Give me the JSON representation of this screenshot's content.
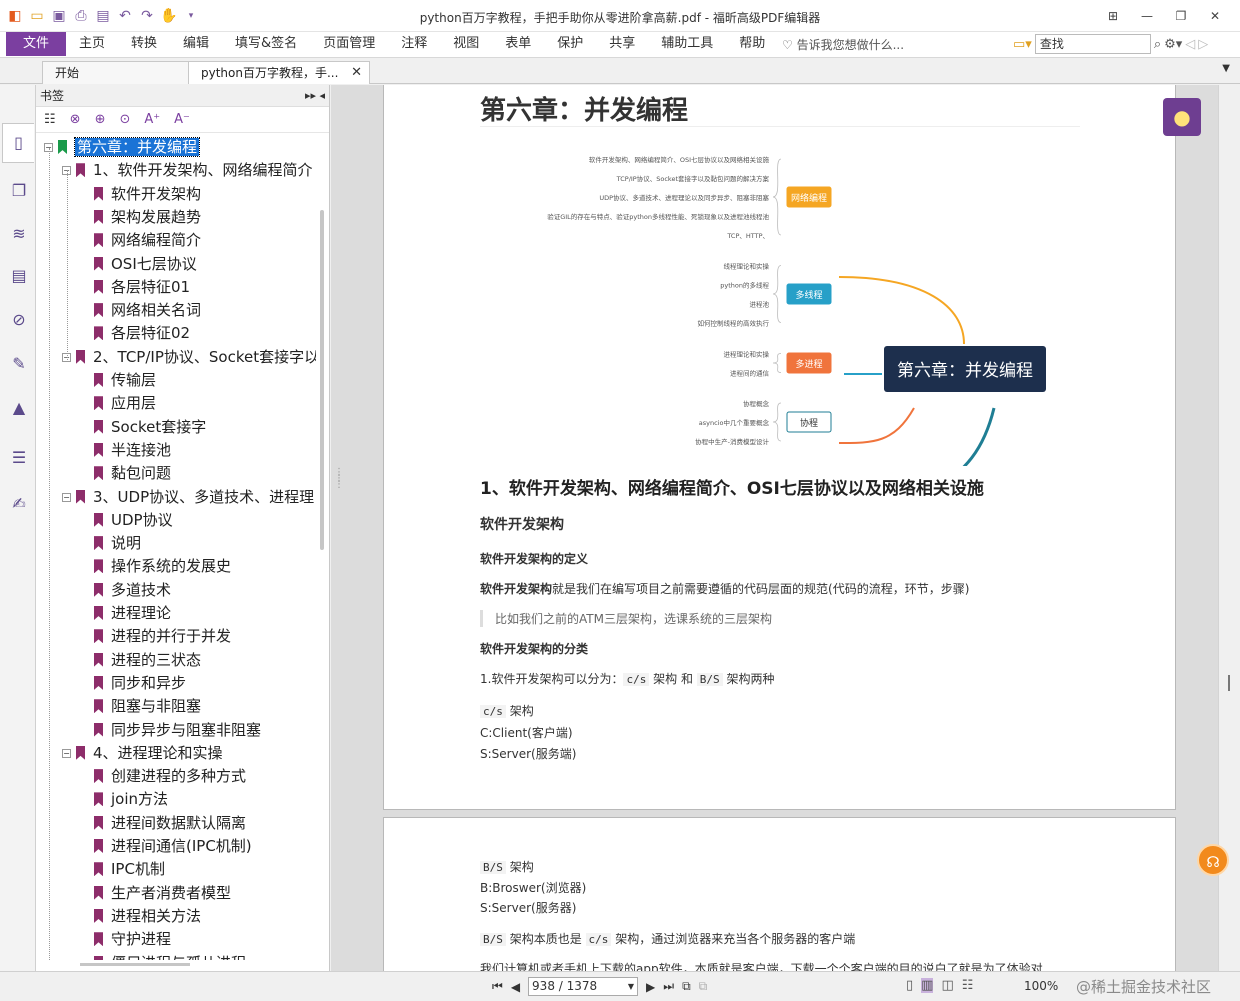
{
  "app": {
    "title": "python百万字教程，手把手助你从零进阶拿高薪.pdf - 福昕高级PDF编辑器",
    "accent": "#7b3fa0"
  },
  "quick_access_icons": [
    "app-logo-icon",
    "open-icon",
    "save-icon",
    "print-icon",
    "scan-icon",
    "undo-icon",
    "redo-icon",
    "hand-tool-icon",
    "customize-icon"
  ],
  "window_controls": [
    "tile-icon",
    "minimize-icon",
    "restore-icon",
    "close-icon"
  ],
  "menu": {
    "file": "文件",
    "items": [
      "主页",
      "转换",
      "编辑",
      "填写&签名",
      "页面管理",
      "注释",
      "视图",
      "表单",
      "保护",
      "共享",
      "辅助工具",
      "帮助"
    ],
    "tell_me": "告诉我您想做什么...",
    "search_placeholder": "查找"
  },
  "tabs": [
    {
      "label": "开始"
    },
    {
      "label": "python百万字教程，手..."
    }
  ],
  "bookmarks": {
    "header": "书签",
    "nodes": [
      {
        "label": "第六章：并发编程",
        "level": 0,
        "toggle": "⊟",
        "selected": true
      },
      {
        "label": "1、软件开发架构、网络编程简介",
        "level": 1,
        "toggle": "⊟"
      },
      {
        "label": "软件开发架构",
        "level": 2
      },
      {
        "label": "架构发展趋势",
        "level": 2
      },
      {
        "label": "网络编程简介",
        "level": 2
      },
      {
        "label": "OSI七层协议",
        "level": 2
      },
      {
        "label": "各层特征01",
        "level": 2
      },
      {
        "label": "网络相关名词",
        "level": 2
      },
      {
        "label": "各层特征02",
        "level": 2
      },
      {
        "label": "2、TCP/IP协议、Socket套接字以",
        "level": 1,
        "toggle": "⊟"
      },
      {
        "label": "传输层",
        "level": 2
      },
      {
        "label": "应用层",
        "level": 2
      },
      {
        "label": "Socket套接字",
        "level": 2
      },
      {
        "label": "半连接池",
        "level": 2
      },
      {
        "label": "黏包问题",
        "level": 2
      },
      {
        "label": "3、UDP协议、多道技术、进程理",
        "level": 1,
        "toggle": "⊟"
      },
      {
        "label": "UDP协议",
        "level": 2
      },
      {
        "label": "说明",
        "level": 2
      },
      {
        "label": "操作系统的发展史",
        "level": 2
      },
      {
        "label": "多道技术",
        "level": 2
      },
      {
        "label": "进程理论",
        "level": 2
      },
      {
        "label": "进程的并行于并发",
        "level": 2
      },
      {
        "label": "进程的三状态",
        "level": 2
      },
      {
        "label": "同步和异步",
        "level": 2
      },
      {
        "label": "阻塞与非阻塞",
        "level": 2
      },
      {
        "label": "同步异步与阻塞非阻塞",
        "level": 2
      },
      {
        "label": "4、进程理论和实操",
        "level": 1,
        "toggle": "⊟"
      },
      {
        "label": "创建进程的多种方式",
        "level": 2
      },
      {
        "label": "join方法",
        "level": 2
      },
      {
        "label": "进程间数据默认隔离",
        "level": 2
      },
      {
        "label": "进程间通信(IPC机制)",
        "level": 2
      },
      {
        "label": "IPC机制",
        "level": 2
      },
      {
        "label": "生产者消费者模型",
        "level": 2
      },
      {
        "label": "进程相关方法",
        "level": 2
      },
      {
        "label": "守护进程",
        "level": 2
      },
      {
        "label": "僵尸进程与孤儿进程",
        "level": 2
      }
    ]
  },
  "document": {
    "chapter_title": "第六章：并发编程",
    "mindmap": {
      "center": "第六章：并发编程",
      "branches": [
        {
          "name": "网络编程",
          "color": "#f5a623",
          "leaves": [
            "软件开发架构、网络编程简介、OSI七层协议以及网络相关设施",
            "TCP/IP协议、Socket套接字以及黏包问题的解决方案",
            "UDP协议、多道技术、进程理论以及同步异步、阻塞非阻塞",
            "验证GIL的存在与特点、验证python多线程性能、死锁现象以及进程池线程池",
            "TCP、HTTP、"
          ]
        },
        {
          "name": "多线程",
          "color": "#27a0c8",
          "leaves": [
            "线程理论和实操",
            "python的多线程",
            "进程池",
            "如何控制线程的高效执行"
          ]
        },
        {
          "name": "多进程",
          "color": "#f0743c",
          "leaves": [
            "进程理论和实操",
            "进程间的通信"
          ]
        },
        {
          "name": "协程",
          "color": "#1f7e94",
          "leaves": [
            "协程概念",
            "asyncio中几个重要概念",
            "协程中生产-消费模型设计"
          ]
        }
      ]
    },
    "section1_title": "1、软件开发架构、网络编程简介、OSI七层协议以及网络相关设施",
    "h_arch": "软件开发架构",
    "h_def": "软件开发架构的定义",
    "def_bold": "软件开发架构",
    "def_rest": "就是我们在编写项目之前需要遵循的代码层面的规范(代码的流程，环节，步骤)",
    "quote": "比如我们之前的ATM三层架构，选课系统的三层架构",
    "h_class": "软件开发架构的分类",
    "class_prefix": "1.软件开发架构可以分为：",
    "cs_code": "c/s",
    "class_mid1": " 架构 和 ",
    "bs_code": "B/S",
    "class_mid2": " 架构两种",
    "cs_title_code": "c/s",
    "cs_title_rest": " 架构",
    "cs_client": "C:Client(客户端)",
    "cs_server": "S:Server(服务端)",
    "bs_title_code": "B/S",
    "bs_title_rest": " 架构",
    "bs_browser": "B:Broswer(浏览器)",
    "bs_server": "S:Server(服务器)",
    "bs_note_code1": "B/S",
    "bs_note_mid": " 架构本质也是 ",
    "bs_note_code2": "c/s",
    "bs_note_rest": " 架构，通过浏览器来充当各个服务器的客户端",
    "last_line": "我们计算机或者手机上下载的app软件，本质就是客户端，下载一个个客户端的目的说白了就是为了体验对"
  },
  "status": {
    "page": "938 / 1378",
    "zoom": "100%",
    "watermark": "@稀土掘金技术社区"
  }
}
